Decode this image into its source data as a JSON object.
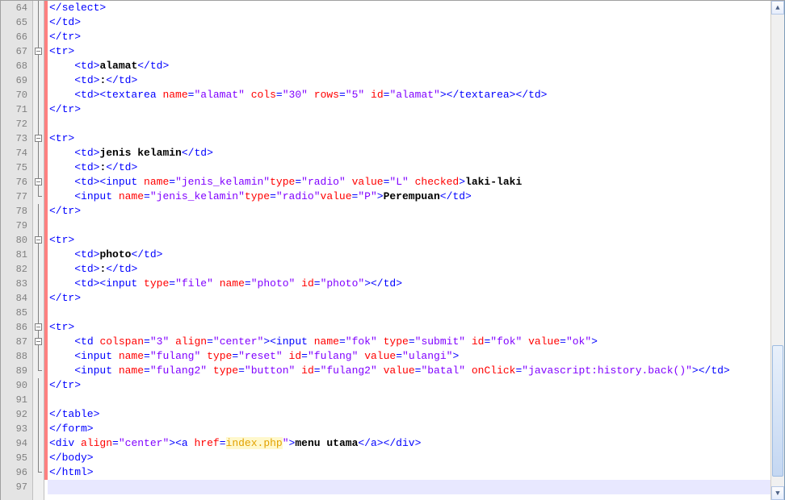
{
  "line_start": 64,
  "line_end": 97,
  "lines": [
    {
      "n": 64,
      "fold": "line",
      "chg": true,
      "segs": [
        [
          "tag",
          "</select>"
        ]
      ]
    },
    {
      "n": 65,
      "fold": "line",
      "chg": true,
      "segs": [
        [
          "tag",
          "</td>"
        ]
      ]
    },
    {
      "n": 66,
      "fold": "line",
      "chg": true,
      "segs": [
        [
          "tag",
          "</tr>"
        ]
      ]
    },
    {
      "n": 67,
      "fold": "box",
      "chg": true,
      "segs": [
        [
          "tag",
          "<tr>"
        ]
      ]
    },
    {
      "n": 68,
      "fold": "line",
      "chg": true,
      "segs": [
        [
          "func",
          "    "
        ],
        [
          "tag",
          "<td>"
        ],
        [
          "text",
          "alamat"
        ],
        [
          "tag",
          "</td>"
        ]
      ]
    },
    {
      "n": 69,
      "fold": "line",
      "chg": true,
      "segs": [
        [
          "func",
          "    "
        ],
        [
          "tag",
          "<td>"
        ],
        [
          "text",
          ":"
        ],
        [
          "tag",
          "</td>"
        ]
      ]
    },
    {
      "n": 70,
      "fold": "line",
      "chg": true,
      "segs": [
        [
          "func",
          "    "
        ],
        [
          "tag",
          "<td><textarea "
        ],
        [
          "attr",
          "name"
        ],
        [
          "tag",
          "="
        ],
        [
          "str",
          "\"alamat\""
        ],
        [
          "tag",
          " "
        ],
        [
          "attr",
          "cols"
        ],
        [
          "tag",
          "="
        ],
        [
          "str",
          "\"30\""
        ],
        [
          "tag",
          " "
        ],
        [
          "attr",
          "rows"
        ],
        [
          "tag",
          "="
        ],
        [
          "str",
          "\"5\""
        ],
        [
          "tag",
          " "
        ],
        [
          "attr",
          "id"
        ],
        [
          "tag",
          "="
        ],
        [
          "str",
          "\"alamat\""
        ],
        [
          "tag",
          "></textarea></td>"
        ]
      ]
    },
    {
      "n": 71,
      "fold": "line",
      "chg": true,
      "segs": [
        [
          "tag",
          "</tr>"
        ]
      ]
    },
    {
      "n": 72,
      "fold": "line",
      "chg": true,
      "segs": []
    },
    {
      "n": 73,
      "fold": "box",
      "chg": true,
      "segs": [
        [
          "tag",
          "<tr>"
        ]
      ]
    },
    {
      "n": 74,
      "fold": "line",
      "chg": true,
      "segs": [
        [
          "func",
          "    "
        ],
        [
          "tag",
          "<td>"
        ],
        [
          "text",
          "jenis kelamin"
        ],
        [
          "tag",
          "</td>"
        ]
      ]
    },
    {
      "n": 75,
      "fold": "line",
      "chg": true,
      "segs": [
        [
          "func",
          "    "
        ],
        [
          "tag",
          "<td>"
        ],
        [
          "text",
          ":"
        ],
        [
          "tag",
          "</td>"
        ]
      ]
    },
    {
      "n": 76,
      "fold": "box",
      "chg": true,
      "segs": [
        [
          "func",
          "    "
        ],
        [
          "tag",
          "<td><input "
        ],
        [
          "attr",
          "name"
        ],
        [
          "tag",
          "="
        ],
        [
          "str",
          "\"jenis_kelamin\""
        ],
        [
          "attr",
          "type"
        ],
        [
          "tag",
          "="
        ],
        [
          "str",
          "\"radio\""
        ],
        [
          "tag",
          " "
        ],
        [
          "attr",
          "value"
        ],
        [
          "tag",
          "="
        ],
        [
          "str",
          "\"L\""
        ],
        [
          "tag",
          " "
        ],
        [
          "attr",
          "checked"
        ],
        [
          "tag",
          ">"
        ],
        [
          "text",
          "laki-laki"
        ]
      ]
    },
    {
      "n": 77,
      "fold": "tail",
      "chg": true,
      "segs": [
        [
          "func",
          "    "
        ],
        [
          "tag",
          "<input "
        ],
        [
          "attr",
          "name"
        ],
        [
          "tag",
          "="
        ],
        [
          "str",
          "\"jenis_kelamin\""
        ],
        [
          "attr",
          "type"
        ],
        [
          "tag",
          "="
        ],
        [
          "str",
          "\"radio\""
        ],
        [
          "attr",
          "value"
        ],
        [
          "tag",
          "="
        ],
        [
          "str",
          "\"P\""
        ],
        [
          "tag",
          ">"
        ],
        [
          "text",
          "Perempuan"
        ],
        [
          "tag",
          "</td>"
        ]
      ]
    },
    {
      "n": 78,
      "fold": "line",
      "chg": true,
      "segs": [
        [
          "tag",
          "</tr>"
        ]
      ]
    },
    {
      "n": 79,
      "fold": "line",
      "chg": true,
      "segs": []
    },
    {
      "n": 80,
      "fold": "box",
      "chg": true,
      "segs": [
        [
          "tag",
          "<tr>"
        ]
      ]
    },
    {
      "n": 81,
      "fold": "line",
      "chg": true,
      "segs": [
        [
          "func",
          "    "
        ],
        [
          "tag",
          "<td>"
        ],
        [
          "text",
          "photo"
        ],
        [
          "tag",
          "</td>"
        ]
      ]
    },
    {
      "n": 82,
      "fold": "line",
      "chg": true,
      "segs": [
        [
          "func",
          "    "
        ],
        [
          "tag",
          "<td>"
        ],
        [
          "text",
          ":"
        ],
        [
          "tag",
          "</td>"
        ]
      ]
    },
    {
      "n": 83,
      "fold": "line",
      "chg": true,
      "segs": [
        [
          "func",
          "    "
        ],
        [
          "tag",
          "<td><input "
        ],
        [
          "attr",
          "type"
        ],
        [
          "tag",
          "="
        ],
        [
          "str",
          "\"file\""
        ],
        [
          "tag",
          " "
        ],
        [
          "attr",
          "name"
        ],
        [
          "tag",
          "="
        ],
        [
          "str",
          "\"photo\""
        ],
        [
          "tag",
          " "
        ],
        [
          "attr",
          "id"
        ],
        [
          "tag",
          "="
        ],
        [
          "str",
          "\"photo\""
        ],
        [
          "tag",
          "></td>"
        ]
      ]
    },
    {
      "n": 84,
      "fold": "line",
      "chg": true,
      "segs": [
        [
          "tag",
          "</tr>"
        ]
      ]
    },
    {
      "n": 85,
      "fold": "line",
      "chg": true,
      "segs": []
    },
    {
      "n": 86,
      "fold": "box",
      "chg": true,
      "segs": [
        [
          "tag",
          "<tr>"
        ]
      ]
    },
    {
      "n": 87,
      "fold": "box",
      "chg": true,
      "segs": [
        [
          "func",
          "    "
        ],
        [
          "tag",
          "<td "
        ],
        [
          "attr",
          "colspan"
        ],
        [
          "tag",
          "="
        ],
        [
          "str",
          "\"3\""
        ],
        [
          "tag",
          " "
        ],
        [
          "attr",
          "align"
        ],
        [
          "tag",
          "="
        ],
        [
          "str",
          "\"center\""
        ],
        [
          "tag",
          "><input "
        ],
        [
          "attr",
          "name"
        ],
        [
          "tag",
          "="
        ],
        [
          "str",
          "\"fok\""
        ],
        [
          "tag",
          " "
        ],
        [
          "attr",
          "type"
        ],
        [
          "tag",
          "="
        ],
        [
          "str",
          "\"submit\""
        ],
        [
          "tag",
          " "
        ],
        [
          "attr",
          "id"
        ],
        [
          "tag",
          "="
        ],
        [
          "str",
          "\"fok\""
        ],
        [
          "tag",
          " "
        ],
        [
          "attr",
          "value"
        ],
        [
          "tag",
          "="
        ],
        [
          "str",
          "\"ok\""
        ],
        [
          "tag",
          ">"
        ]
      ]
    },
    {
      "n": 88,
      "fold": "line",
      "chg": true,
      "segs": [
        [
          "func",
          "    "
        ],
        [
          "tag",
          "<input "
        ],
        [
          "attr",
          "name"
        ],
        [
          "tag",
          "="
        ],
        [
          "str",
          "\"fulang\""
        ],
        [
          "tag",
          " "
        ],
        [
          "attr",
          "type"
        ],
        [
          "tag",
          "="
        ],
        [
          "str",
          "\"reset\""
        ],
        [
          "tag",
          " "
        ],
        [
          "attr",
          "id"
        ],
        [
          "tag",
          "="
        ],
        [
          "str",
          "\"fulang\""
        ],
        [
          "tag",
          " "
        ],
        [
          "attr",
          "value"
        ],
        [
          "tag",
          "="
        ],
        [
          "str",
          "\"ulangi\""
        ],
        [
          "tag",
          ">"
        ]
      ]
    },
    {
      "n": 89,
      "fold": "tail",
      "chg": true,
      "segs": [
        [
          "func",
          "    "
        ],
        [
          "tag",
          "<input "
        ],
        [
          "attr",
          "name"
        ],
        [
          "tag",
          "="
        ],
        [
          "str",
          "\"fulang2\""
        ],
        [
          "tag",
          " "
        ],
        [
          "attr",
          "type"
        ],
        [
          "tag",
          "="
        ],
        [
          "str",
          "\"button\""
        ],
        [
          "tag",
          " "
        ],
        [
          "attr",
          "id"
        ],
        [
          "tag",
          "="
        ],
        [
          "str",
          "\"fulang2\""
        ],
        [
          "tag",
          " "
        ],
        [
          "attr",
          "value"
        ],
        [
          "tag",
          "="
        ],
        [
          "str",
          "\"batal\""
        ],
        [
          "tag",
          " "
        ],
        [
          "attr",
          "onClick"
        ],
        [
          "tag",
          "="
        ],
        [
          "str",
          "\"javascript:history.back()\""
        ],
        [
          "tag",
          "></td>"
        ]
      ]
    },
    {
      "n": 90,
      "fold": "line",
      "chg": true,
      "segs": [
        [
          "tag",
          "</tr>"
        ]
      ]
    },
    {
      "n": 91,
      "fold": "line",
      "chg": true,
      "segs": []
    },
    {
      "n": 92,
      "fold": "line",
      "chg": true,
      "segs": [
        [
          "tag",
          "</table>"
        ]
      ]
    },
    {
      "n": 93,
      "fold": "line",
      "chg": true,
      "segs": [
        [
          "tag",
          "</form>"
        ]
      ]
    },
    {
      "n": 94,
      "fold": "line",
      "chg": true,
      "segs": [
        [
          "tag",
          "<div "
        ],
        [
          "attr",
          "align"
        ],
        [
          "tag",
          "="
        ],
        [
          "str",
          "\"center\""
        ],
        [
          "tag",
          "><a "
        ],
        [
          "attr",
          "href"
        ],
        [
          "tag",
          "="
        ],
        [
          "link",
          "index.php"
        ],
        [
          "str",
          "\""
        ],
        [
          "tag",
          ">"
        ],
        [
          "text",
          "menu utama"
        ],
        [
          "tag",
          "</a></div>"
        ]
      ]
    },
    {
      "n": 95,
      "fold": "line",
      "chg": true,
      "segs": [
        [
          "tag",
          "</body>"
        ]
      ]
    },
    {
      "n": 96,
      "fold": "tail",
      "chg": true,
      "segs": [
        [
          "tag",
          "</html>"
        ]
      ]
    },
    {
      "n": 97,
      "fold": "none",
      "chg": false,
      "current": true,
      "segs": []
    }
  ],
  "scrollbar": {
    "thumb_top_pct": 70,
    "thumb_height_pct": 28
  }
}
